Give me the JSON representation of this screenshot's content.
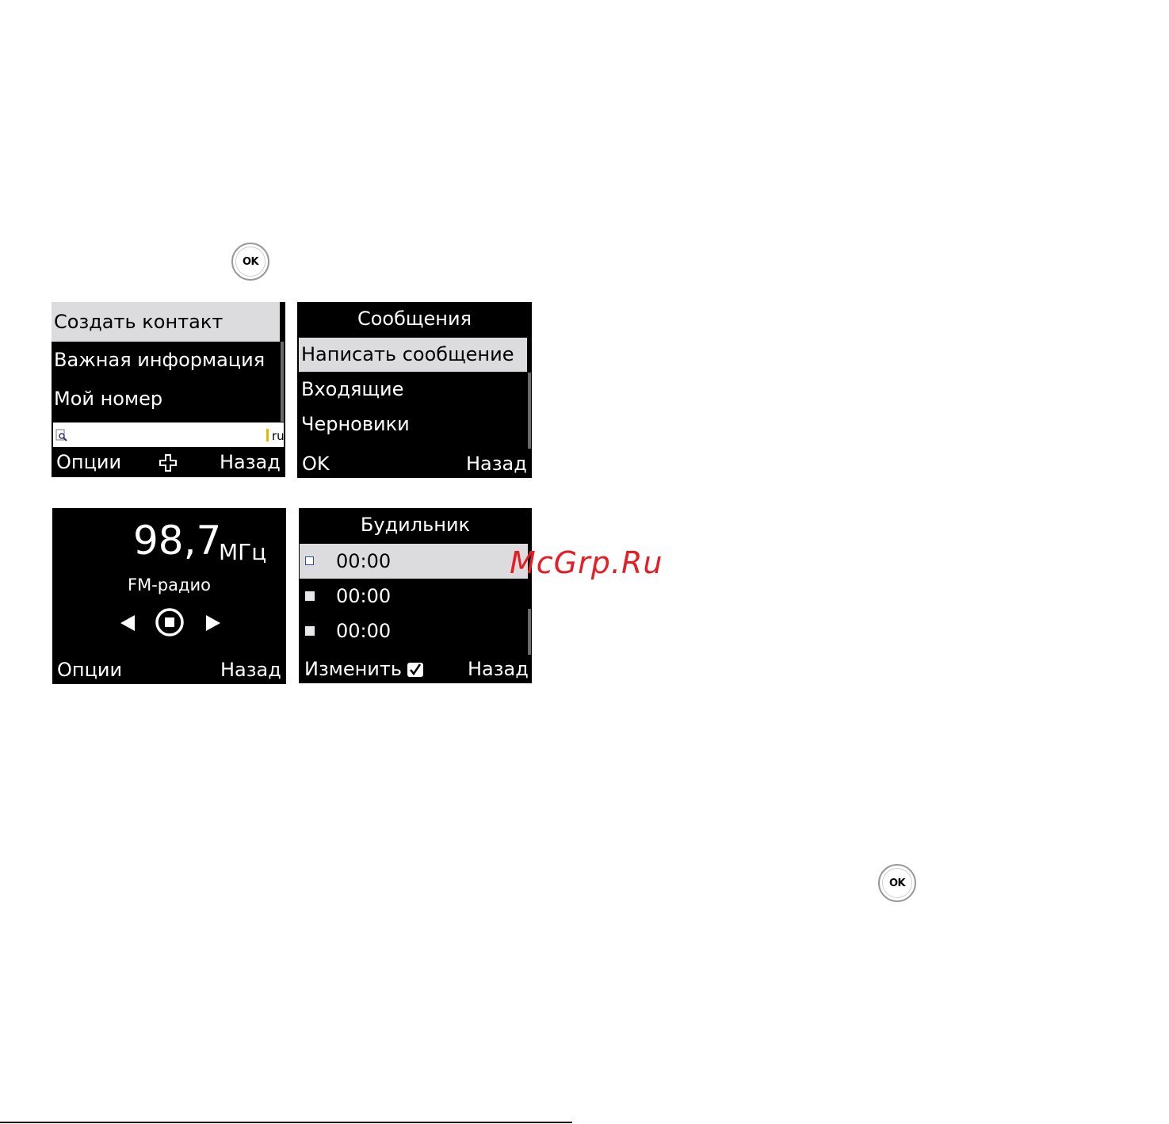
{
  "ok_button_label": "OK",
  "screen_contacts": {
    "items": [
      "Создать контакт",
      "Важная информация",
      "Мой номер"
    ],
    "input_lang": "ru",
    "soft_left": "Опции",
    "soft_right": "Назад"
  },
  "screen_messages": {
    "title": "Сообщения",
    "items": [
      "Написать сообщение",
      "Входящие",
      "Черновики"
    ],
    "soft_left": "OK",
    "soft_right": "Назад"
  },
  "screen_radio": {
    "frequency": "98,7",
    "unit": "МГц",
    "label": "FM-радио",
    "soft_left": "Опции",
    "soft_right": "Назад"
  },
  "screen_alarm": {
    "title": "Будильник",
    "alarms": [
      "00:00",
      "00:00",
      "00:00"
    ],
    "soft_left": "Изменить",
    "soft_right": "Назад"
  },
  "watermark": "McGrp.Ru"
}
